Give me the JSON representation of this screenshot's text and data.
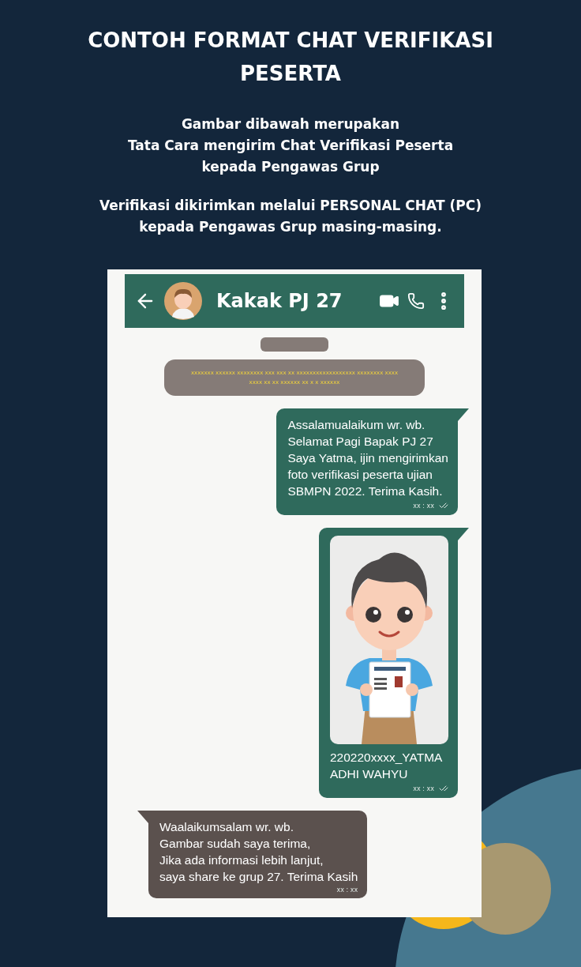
{
  "title": "CONTOH FORMAT CHAT VERIFIKASI PESERTA",
  "intro": "Gambar dibawah merupakan\nTata Cara mengirim Chat Verifikasi Peserta\nkepada Pengawas Grup",
  "note": "Verifikasi dikirimkan melalui PERSONAL CHAT (PC)\nkepada Pengawas Grup masing-masing.",
  "chat": {
    "contact": "Kakak PJ 27",
    "system_notice": "xxxxxxx xxxxxx xxxxxxxx xxx xxx xx xxxxxxxxxxxxxxxxxx xxxxxxxx xxxx\nxxxx xx xx xxxxxx xx x x xxxxxx",
    "messages": [
      {
        "kind": "text",
        "outgoing": true,
        "text": "Assalamualaikum wr. wb.\nSelamat Pagi Bapak PJ 27\nSaya Yatma, ijin mengirimkan\nfoto verifikasi peserta ujian\nSBMPN 2022. Terima Kasih.",
        "time": "xx : xx",
        "read": true
      },
      {
        "kind": "image",
        "outgoing": true,
        "text": "220220xxxx_YATMA\nADHI WAHYU",
        "time": "xx : xx",
        "read": true
      },
      {
        "kind": "text",
        "outgoing": false,
        "text": "Waalaikumsalam wr. wb.\nGambar sudah saya terima,\nJika ada informasi lebih lanjut,\nsaya share ke grup 27. Terima Kasih",
        "time": "xx : xx"
      }
    ]
  }
}
